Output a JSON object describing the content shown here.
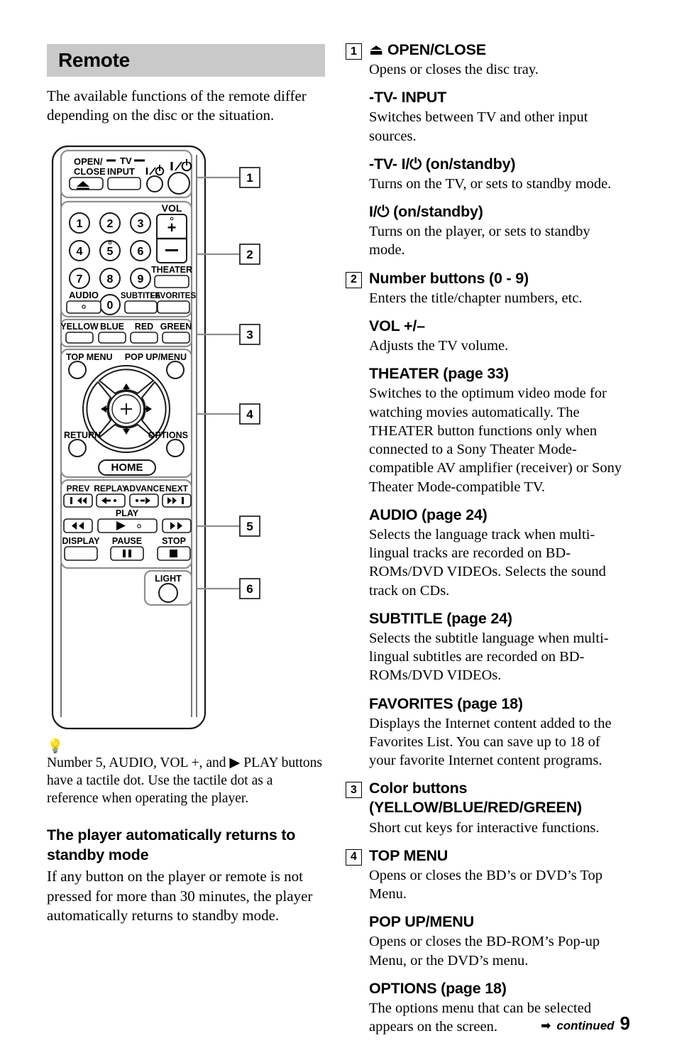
{
  "section": {
    "heading": "Remote",
    "intro": "The available functions of the remote differ depending on the disc or the situation."
  },
  "remote_diagram": {
    "callouts": [
      "1",
      "2",
      "3",
      "4",
      "5",
      "6"
    ],
    "group1": {
      "open_close": "OPEN/\nCLOSE",
      "open_close_line1": "OPEN/",
      "open_close_line2": "CLOSE",
      "tv_label": "TV",
      "input": "INPUT",
      "tv_power": "I/⏻",
      "player_power": "I/⏻"
    },
    "group2": {
      "numbers": [
        "1",
        "2",
        "3",
        "4",
        "5",
        "6",
        "7",
        "8",
        "9",
        "0"
      ],
      "vol_label": "VOL",
      "vol_plus": "+",
      "vol_minus": "−",
      "theater": "THEATER",
      "audio": "AUDIO",
      "subtitle": "SUBTITLE",
      "favorites": "FAVORITES"
    },
    "group3": {
      "color_buttons": [
        "YELLOW",
        "BLUE",
        "RED",
        "GREEN"
      ]
    },
    "group4": {
      "top_menu": "TOP MENU",
      "pop_up_menu": "POP UP/MENU",
      "return": "RETURN",
      "options": "OPTIONS",
      "home": "HOME"
    },
    "group5": {
      "prev": "PREV",
      "replay": "REPLAY",
      "advance": "ADVANCE",
      "next": "NEXT",
      "play": "PLAY",
      "display": "DISPLAY",
      "pause": "PAUSE",
      "stop": "STOP"
    },
    "group6": {
      "light": "LIGHT"
    }
  },
  "tip": {
    "icon": "tip-bulb-icon",
    "text": "Number 5, AUDIO, VOL +, and ▶ PLAY buttons have a tactile dot. Use the tactile dot as a reference when operating the player."
  },
  "standby_note": {
    "heading": "The player automatically returns to standby mode",
    "body": "If any button on the player or remote is not pressed for more than 30 minutes, the player automatically returns to standby mode."
  },
  "descriptions": [
    {
      "num": "1",
      "items": [
        {
          "title": "⏏ OPEN/CLOSE",
          "body": "Opens or closes the disc tray."
        },
        {
          "title": "-TV- INPUT",
          "body": "Switches between TV and other input sources."
        },
        {
          "title": "-TV- I/⏻ (on/standby)",
          "body": "Turns on the TV, or sets to standby mode."
        },
        {
          "title": "I/⏻ (on/standby)",
          "body": "Turns on the player, or sets to standby mode."
        }
      ]
    },
    {
      "num": "2",
      "items": [
        {
          "title": "Number buttons (0 - 9)",
          "body": "Enters the title/chapter numbers, etc."
        },
        {
          "title": "VOL +/–",
          "body": "Adjusts the TV volume."
        },
        {
          "title": "THEATER (page 33)",
          "body": "Switches to the optimum video mode for watching movies automatically.\nThe THEATER button functions only when connected to a Sony Theater Mode-compatible AV amplifier (receiver) or Sony Theater Mode-compatible TV."
        },
        {
          "title": "AUDIO (page 24)",
          "body": "Selects the language track when multi-lingual tracks are recorded on BD-ROMs/DVD VIDEOs.\nSelects the sound track on CDs."
        },
        {
          "title": "SUBTITLE (page 24)",
          "body": "Selects the subtitle language when multi-lingual subtitles are recorded on BD-ROMs/DVD VIDEOs."
        },
        {
          "title": "FAVORITES (page 18)",
          "body": "Displays the Internet content added to the Favorites List. You can save up to 18 of your favorite Internet content programs."
        }
      ]
    },
    {
      "num": "3",
      "items": [
        {
          "title": "Color buttons (YELLOW/BLUE/RED/GREEN)",
          "body": "Short cut keys for interactive functions."
        }
      ]
    },
    {
      "num": "4",
      "items": [
        {
          "title": "TOP MENU",
          "body": "Opens or closes the BD’s or DVD’s Top Menu."
        },
        {
          "title": "POP UP/MENU",
          "body": "Opens or closes the BD-ROM’s Pop-up Menu, or the DVD’s menu."
        },
        {
          "title": "OPTIONS (page 18)",
          "body": "The options menu that can be selected appears on the screen."
        }
      ]
    }
  ],
  "footer": {
    "continued": "continued",
    "page_number": "9",
    "arrow": "➡"
  },
  "colors": {
    "band": "#c9c9c9",
    "text": "#000000",
    "remote_outline": "#1a1a1a",
    "remote_fill": "#ffffff",
    "callout_line": "#808080"
  }
}
